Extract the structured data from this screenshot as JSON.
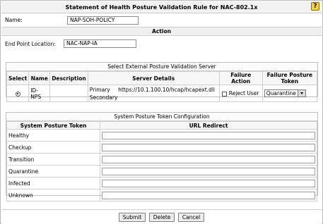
{
  "header": {
    "title": "Statement of Health Posture Validation Rule for NAC-802.1x",
    "help_glyph": "?"
  },
  "name_field": {
    "label": "Name:",
    "value": "NAP-SOH-POLICY"
  },
  "action_section": {
    "title": "Action"
  },
  "endpoint_field": {
    "label": "End Point Location:",
    "value": "NAC-NAP-IA"
  },
  "external_server": {
    "title": "Select External Posture Validation Server",
    "columns": [
      "Select",
      "Name",
      "Description",
      "Server Details",
      "Failure Action",
      "Failure Posture Token"
    ],
    "row": {
      "name": "ID-NPS",
      "description": "",
      "primary_label": "Primary",
      "primary_url": "https://10.1.100.10/hcap/hcapext.dll",
      "secondary_label": "Secondary",
      "failure_action": "Reject User",
      "failure_token": "Quarantine"
    }
  },
  "token_config": {
    "title": "System Posture Token Configuration",
    "columns": [
      "System Posture Token",
      "URL Redirect"
    ],
    "tokens": [
      {
        "name": "Healthy",
        "url": ""
      },
      {
        "name": "Checkup",
        "url": ""
      },
      {
        "name": "Transition",
        "url": ""
      },
      {
        "name": "Quarantine",
        "url": ""
      },
      {
        "name": "Infected",
        "url": ""
      },
      {
        "name": "Unknown",
        "url": ""
      }
    ]
  },
  "footer": {
    "submit_label": "Submit",
    "delete_label": "Delete",
    "cancel_label": "Cancel"
  }
}
